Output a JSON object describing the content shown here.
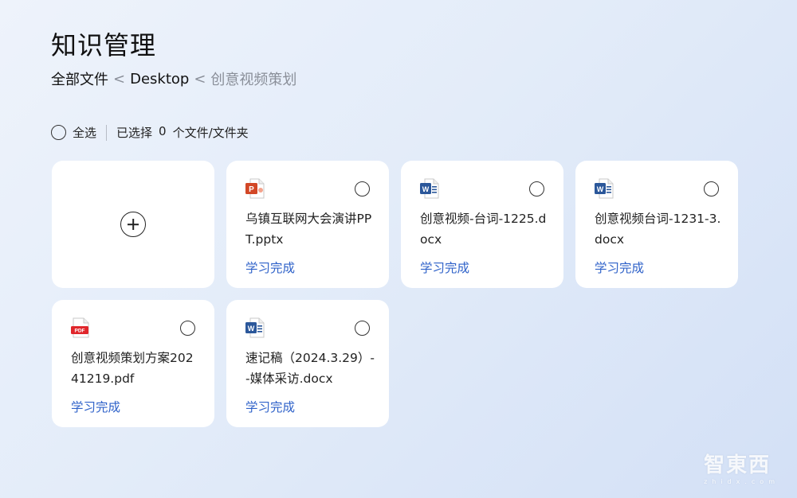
{
  "page": {
    "title": "知识管理"
  },
  "breadcrumb": {
    "items": [
      "全部文件",
      "Desktop",
      "创意视频策划"
    ],
    "separator": "<"
  },
  "selection": {
    "select_all_label": "全选",
    "selected_prefix": "已选择",
    "selected_count": "0",
    "selected_suffix": "个文件/文件夹"
  },
  "add_card": {
    "icon": "plus-circle-icon"
  },
  "files": [
    {
      "name": "乌镇互联网大会演讲PPT.pptx",
      "type": "pptx",
      "icon": "ppt-icon",
      "status": "学习完成"
    },
    {
      "name": "创意视频-台词-1225.docx",
      "type": "docx",
      "icon": "word-icon",
      "status": "学习完成"
    },
    {
      "name": "创意视频台词-1231-3.docx",
      "type": "docx",
      "icon": "word-icon",
      "status": "学习完成"
    },
    {
      "name": "创意视频策划方案20241219.pdf",
      "type": "pdf",
      "icon": "pdf-icon",
      "status": "学习完成"
    },
    {
      "name": "速记稿（2024.3.29）--媒体采访.docx",
      "type": "docx",
      "icon": "word-icon",
      "status": "学习完成"
    }
  ],
  "colors": {
    "status": "#2f62c9",
    "ppt": "#d24726",
    "word": "#2b579a",
    "pdf": "#e0262b"
  },
  "watermark": {
    "brand": "智東西",
    "sub": "zhidx.com"
  }
}
